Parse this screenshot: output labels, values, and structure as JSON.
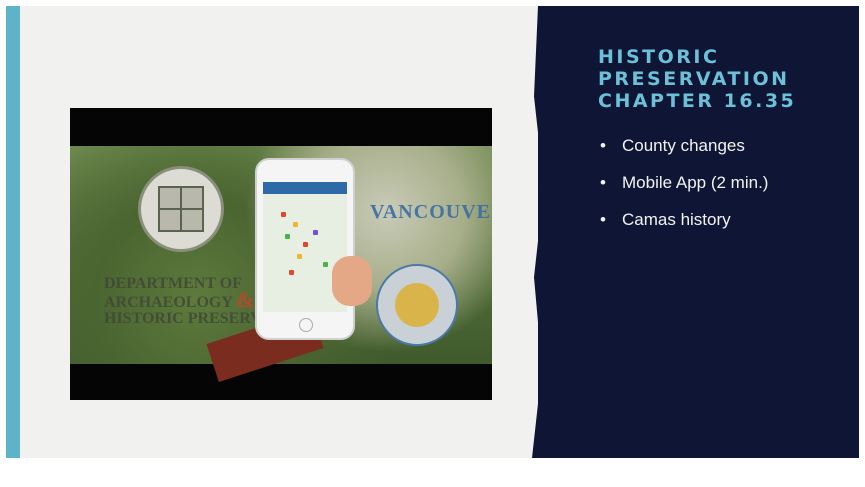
{
  "slide": {
    "title_lines": [
      "HISTORIC",
      "PRESERVATION",
      "CHAPTER 16.35"
    ],
    "bullets": [
      "County changes",
      "Mobile App (2 min.)",
      "Camas history"
    ]
  },
  "video": {
    "embedded_text": {
      "dept_line1": "DEPARTMENT OF",
      "dept_line2": "ARCHAEOLOGY",
      "dept_amp": "&",
      "dept_line3": "HISTORIC PRESERVATION",
      "vancouver": "VANCOUVER"
    }
  },
  "colors": {
    "panel_background": "#0f1535",
    "title": "#6cc1d8",
    "accent_bar": "#5fb3c8",
    "slide_background": "#f1f1ef"
  }
}
